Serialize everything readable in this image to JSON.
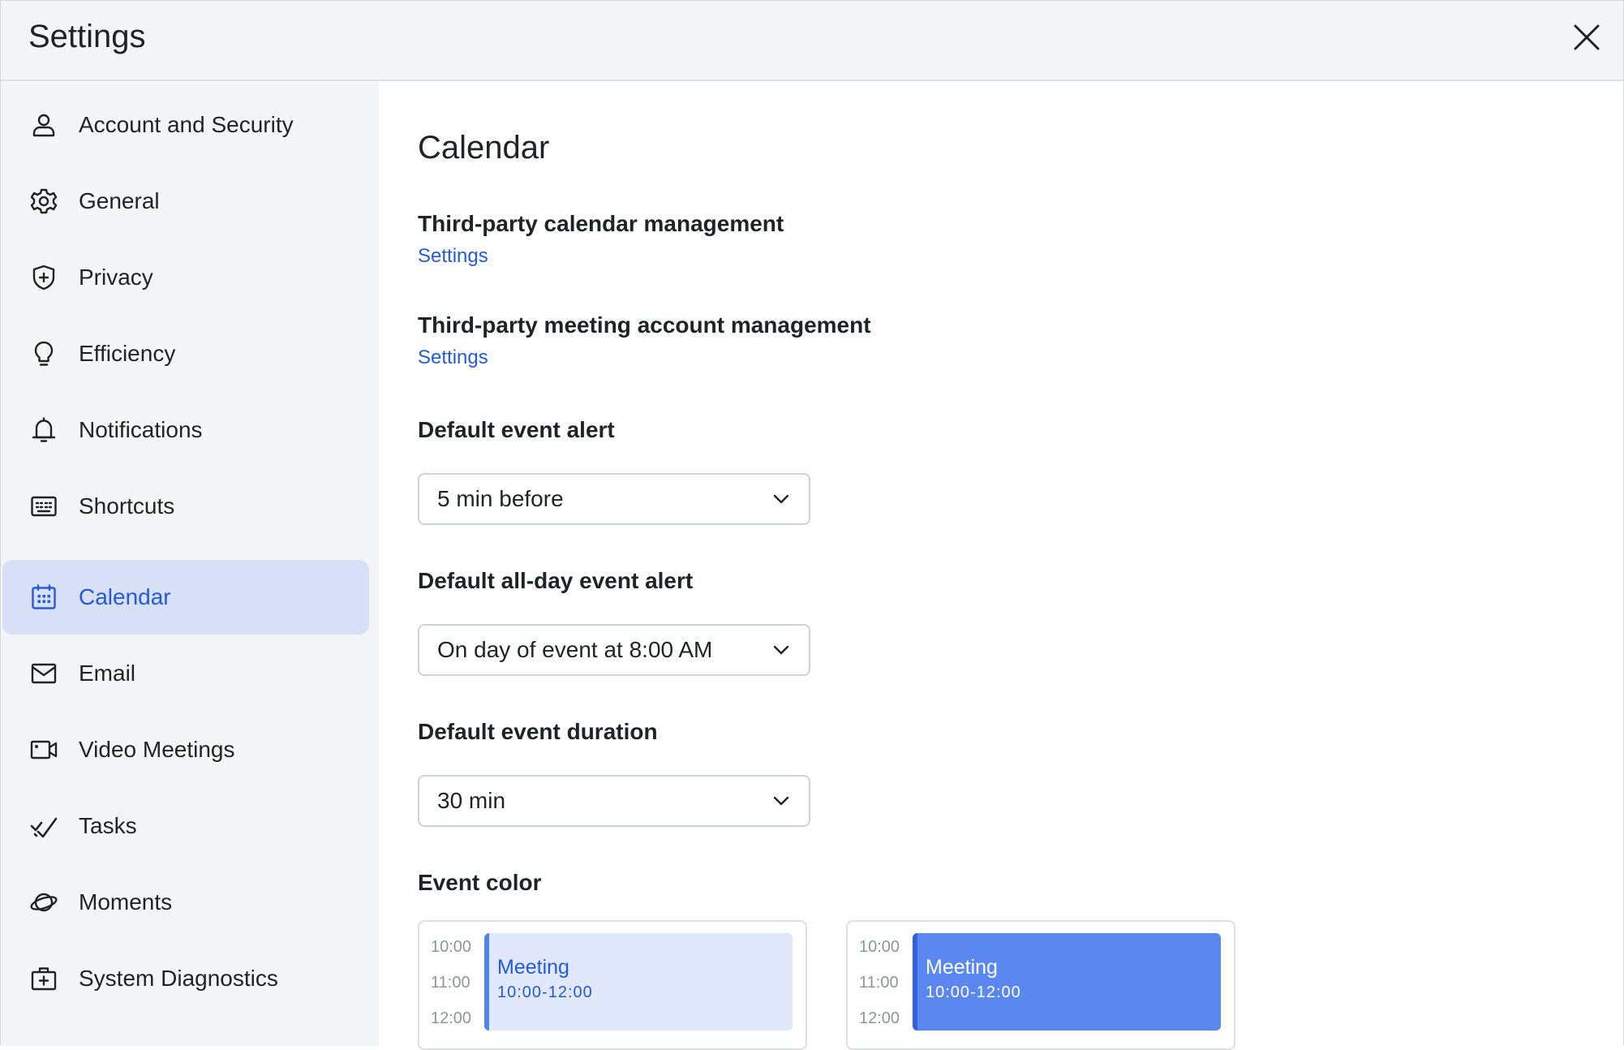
{
  "window": {
    "title": "Settings"
  },
  "sidebar": {
    "items": [
      {
        "label": "Account and Security",
        "icon": "user-icon",
        "active": false
      },
      {
        "label": "General",
        "icon": "gear-icon",
        "active": false
      },
      {
        "label": "Privacy",
        "icon": "shield-icon",
        "active": false
      },
      {
        "label": "Efficiency",
        "icon": "lightbulb-icon",
        "active": false
      },
      {
        "label": "Notifications",
        "icon": "bell-icon",
        "active": false
      },
      {
        "label": "Shortcuts",
        "icon": "keyboard-icon",
        "active": false
      },
      {
        "label": "Calendar",
        "icon": "calendar-icon",
        "active": true
      },
      {
        "label": "Email",
        "icon": "mail-icon",
        "active": false
      },
      {
        "label": "Video Meetings",
        "icon": "video-icon",
        "active": false
      },
      {
        "label": "Tasks",
        "icon": "tasks-check-icon",
        "active": false
      },
      {
        "label": "Moments",
        "icon": "planet-icon",
        "active": false
      },
      {
        "label": "System Diagnostics",
        "icon": "medkit-icon",
        "active": false
      }
    ]
  },
  "main": {
    "title": "Calendar",
    "third_party_calendar": {
      "label": "Third-party calendar management",
      "link": "Settings"
    },
    "third_party_meeting": {
      "label": "Third-party meeting account management",
      "link": "Settings"
    },
    "default_event_alert": {
      "label": "Default event alert",
      "value": "5 min before"
    },
    "default_allday_alert": {
      "label": "Default all-day event alert",
      "value": "On day of event at 8:00 AM"
    },
    "default_duration": {
      "label": "Default event duration",
      "value": "30 min"
    },
    "event_color": {
      "label": "Event color",
      "options": [
        {
          "times": [
            "10:00",
            "11:00",
            "12:00"
          ],
          "title": "Meeting",
          "time_range": "10:00-12:00",
          "style": "light",
          "fill": "#e1e8fb",
          "bar": "#4e83f3",
          "text_color": "#245bdb"
        },
        {
          "times": [
            "10:00",
            "11:00",
            "12:00"
          ],
          "title": "Meeting",
          "time_range": "10:00-12:00",
          "style": "solid",
          "fill": "#5b87f0",
          "bar": "#2f62e0",
          "text_color": "#ffffff"
        }
      ]
    }
  },
  "colors": {
    "accent": "#245bdb",
    "active_nav_bg": "#d7e0f6",
    "sidebar_bg": "#f4f5f6"
  }
}
